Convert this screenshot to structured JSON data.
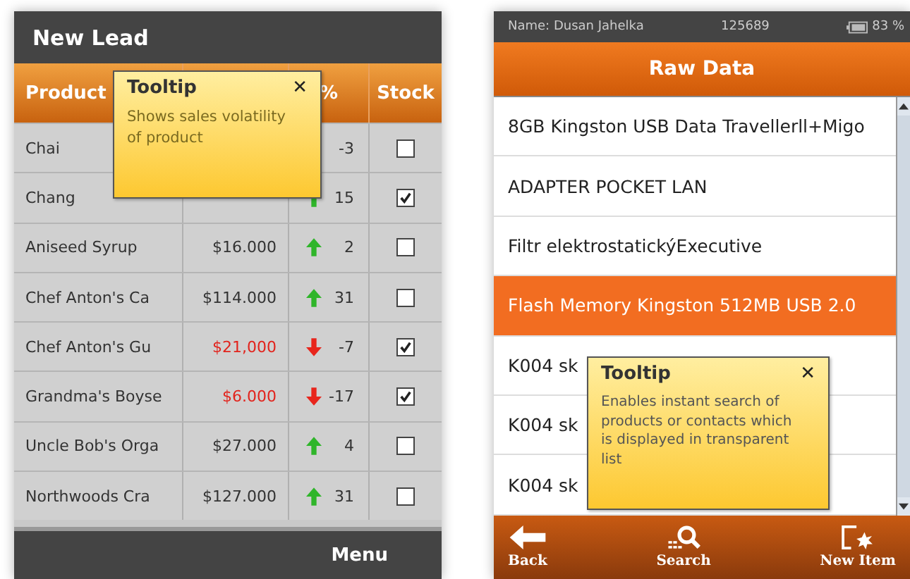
{
  "left_screen": {
    "title": "New Lead",
    "table": {
      "columns": [
        {
          "label": "Product"
        },
        {
          "label": "%"
        },
        {
          "label": "Stock"
        }
      ],
      "rows": [
        {
          "product": "Chai",
          "change": "-3",
          "stock": false
        },
        {
          "product": "Chang",
          "change": "15",
          "rising": true,
          "stock": true
        },
        {
          "product": "Aniseed Syrup",
          "price": "$16.000",
          "change": "2",
          "rising": true,
          "stock": false
        },
        {
          "product": "Chef Anton's Ca",
          "price": "$114.000",
          "change": "31",
          "rising": true,
          "stock": false
        },
        {
          "product": "Chef Anton's Gu",
          "price": "$21,000",
          "change": "-7",
          "rising": false,
          "stock": true
        },
        {
          "product": "Grandma's Boyse",
          "price": "$6.000",
          "change": "-17",
          "rising": false,
          "stock": true
        },
        {
          "product": "Uncle Bob's Orga",
          "price": "$27.000",
          "change": "4",
          "rising": true,
          "stock": false
        },
        {
          "product": "Northwoods Cra",
          "price": "$127.000",
          "change": "31",
          "rising": true,
          "stock": false
        }
      ]
    },
    "tooltip": {
      "title": "Tooltip",
      "close": "✕",
      "text": "Shows sales volatility of product"
    },
    "menu": "Menu"
  },
  "right_screen": {
    "status_bar": {
      "name": "Name: Dusan Jahelka",
      "number": "125689",
      "battery": "83 %"
    },
    "title": "Raw Data",
    "list": [
      {
        "label": "8GB Kingston USB Data Travellerll+Migo",
        "selected": false
      },
      {
        "label": "ADAPTER POCKET LAN",
        "selected": false
      },
      {
        "label": "Filtr elektrostatickýExecutive",
        "selected": false
      },
      {
        "label": "Flash Memory Kingston 512MB USB 2.0",
        "selected": true
      },
      {
        "label": "K004 sk",
        "selected": false
      },
      {
        "label": "K004 sk",
        "selected": false
      },
      {
        "label": "K004 sk",
        "selected": false
      }
    ],
    "tooltip": {
      "title": "Tooltip",
      "close": "✕",
      "text": "Enables instant search of products or contacts which is displayed in transparent list"
    },
    "toolbar": [
      {
        "kind": "back",
        "label": "Back"
      },
      {
        "kind": "search",
        "label": "Search"
      },
      {
        "kind": "new",
        "label": "New Item"
      }
    ]
  }
}
